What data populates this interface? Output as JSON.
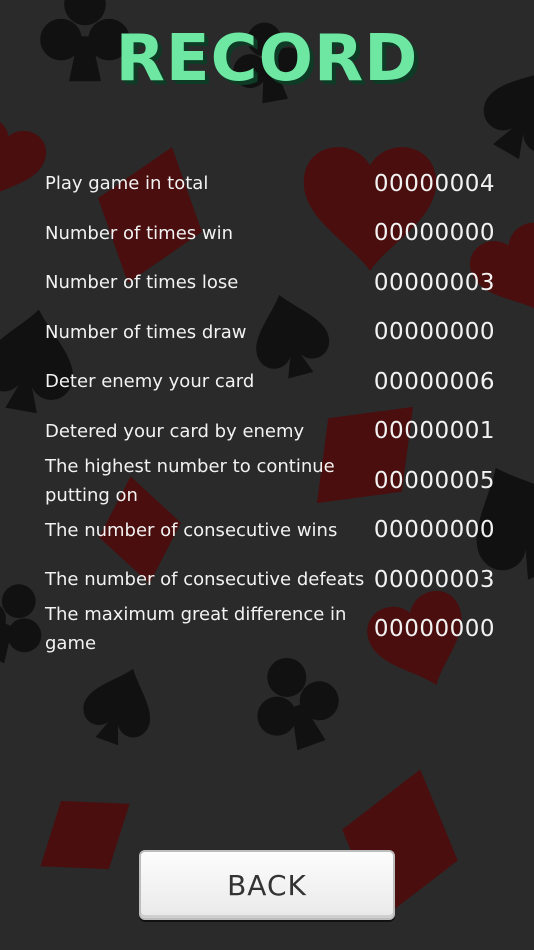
{
  "screen": {
    "title": "RECORD",
    "colors": {
      "background": "#2a2a2a",
      "title": "#6ee7a3",
      "title_shadow": "#0d3b25",
      "text": "#f2f2f2",
      "suit_dark": "#111111",
      "suit_red": "#4a0e0e"
    }
  },
  "records": [
    {
      "label": "Play game in total",
      "value": "00000004"
    },
    {
      "label": "Number of times win",
      "value": "00000000"
    },
    {
      "label": "Number of times lose",
      "value": "00000003"
    },
    {
      "label": "Number of times draw",
      "value": "00000000"
    },
    {
      "label": "Deter enemy your card",
      "value": "00000006"
    },
    {
      "label": "Detered your card by enemy",
      "value": "00000001"
    },
    {
      "label": "The highest number to continue putting on",
      "value": "00000005"
    },
    {
      "label": "The number of consecutive wins",
      "value": "00000000"
    },
    {
      "label": "The number of consecutive defeats",
      "value": "00000003"
    },
    {
      "label": "The maximum great difference in game",
      "value": "00000000"
    }
  ],
  "back_button": {
    "label": "BACK"
  }
}
